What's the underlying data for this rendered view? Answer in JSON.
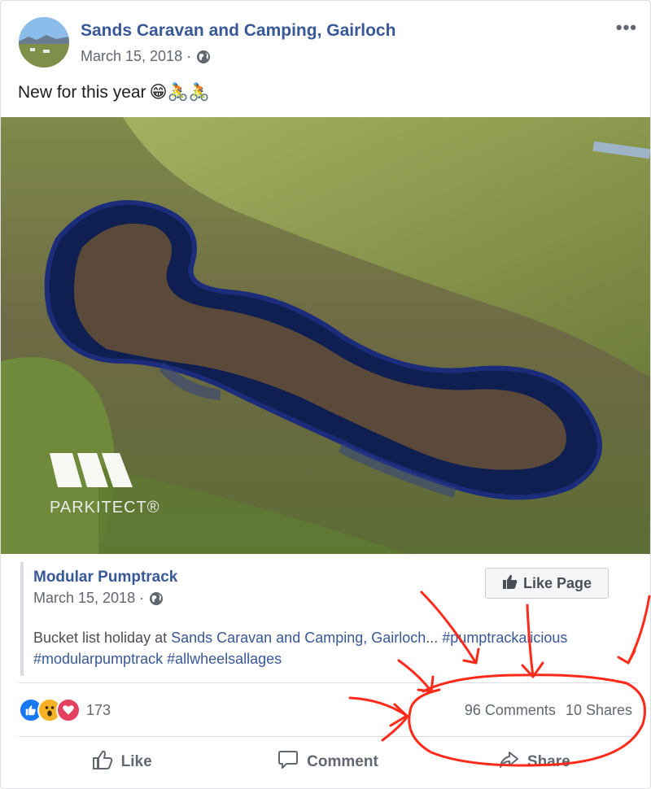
{
  "post": {
    "page_name": "Sands Caravan and Camping, Gairloch",
    "date": "March 15, 2018 ·",
    "more": "•••",
    "text": "New for this year",
    "text_emojis": "😁🚴🚴"
  },
  "photo": {
    "watermark_text": "PARKITECT®"
  },
  "shared": {
    "title": "Modular Pumptrack",
    "date": "March 15, 2018 ·",
    "like_page_label": "Like Page",
    "desc_prefix": "Bucket list holiday at ",
    "desc_link": "Sands Caravan and Camping, Gairloch",
    "desc_ellipsis": "... ",
    "hashtags": [
      "#pumptrackalicious",
      "#modularpumptrack",
      "#allwheelsallages"
    ]
  },
  "stats": {
    "reaction_count": "173",
    "comments": "96 Comments",
    "shares": "10 Shares"
  },
  "actions": {
    "like": "Like",
    "comment": "Comment",
    "share": "Share"
  },
  "colors": {
    "link": "#385898",
    "annotation": "#ff2a1a",
    "like_blue": "#1877f2"
  },
  "icons": [
    "globe-icon",
    "thumbs-up-icon",
    "comment-icon",
    "share-icon",
    "like-reaction-icon",
    "wow-reaction-icon",
    "love-reaction-icon"
  ]
}
